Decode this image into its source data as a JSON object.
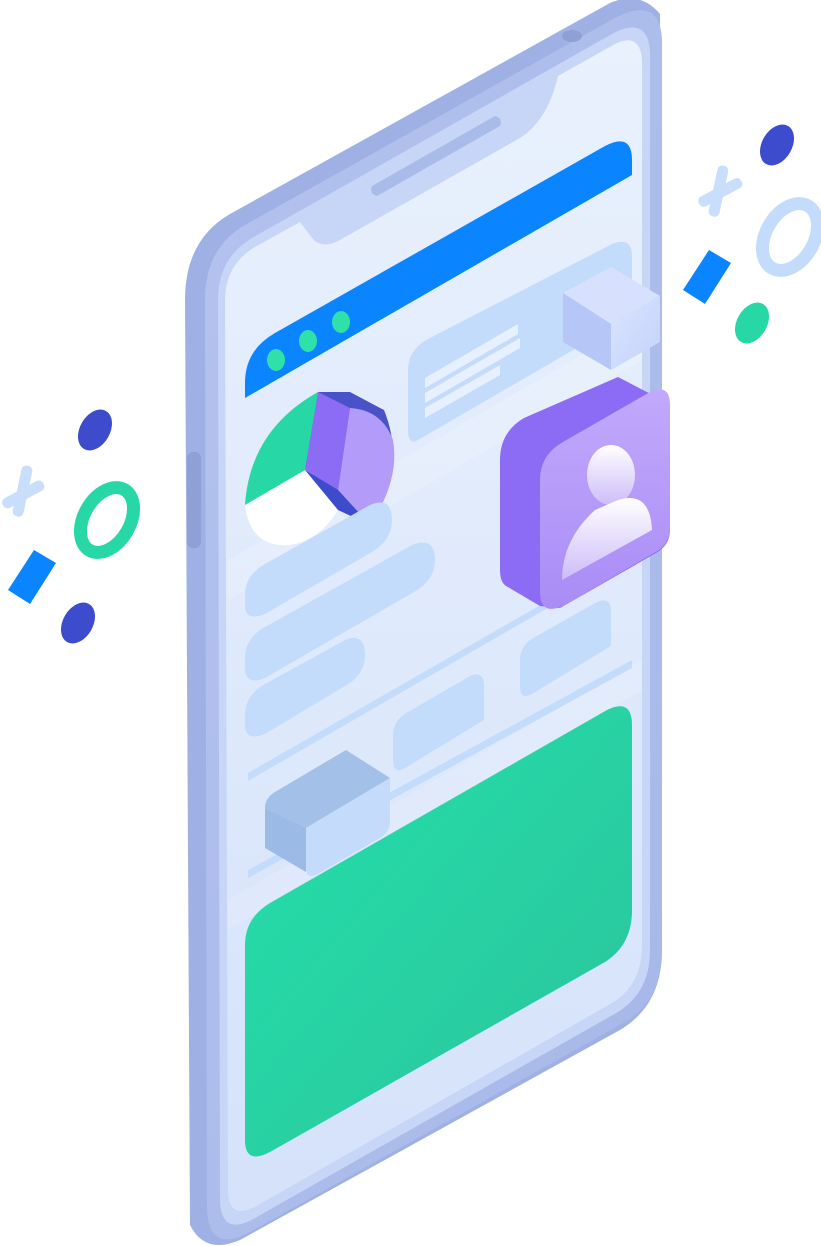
{
  "illustration": {
    "subject": "isometric-smartphone",
    "screen": {
      "header_dots": 3,
      "text_placeholder_bars": 4,
      "cards": [
        "pie-chart-card",
        "profile-card",
        "green-banner-card"
      ]
    },
    "decorations": [
      "x-mark",
      "ring",
      "dot",
      "diamond"
    ]
  },
  "palette": {
    "phone_body": "#aebde9",
    "phone_edge": "#c4d4f6",
    "screen_bg": "#e3ecfb",
    "header_bar": "#0a84ff",
    "header_dots": "#2fe1a9",
    "placeholder": "#c4dcfb",
    "pie_green": "#27d8a6",
    "pie_purple": "#8c6cf5",
    "pie_light_purple": "#b39bf9",
    "profile_card": "#8c6cf5",
    "profile_face": "#b39bf9",
    "banner_green": "#27cf9f",
    "accent_navy": "#3c4ccc",
    "accent_blue": "#0a84ff"
  }
}
